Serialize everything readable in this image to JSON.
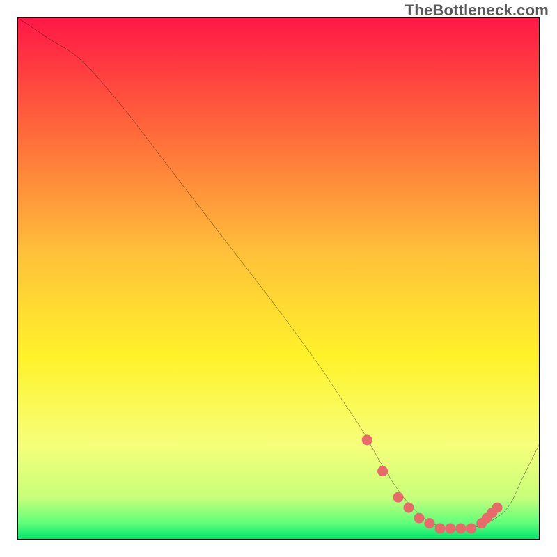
{
  "watermark": "TheBottleneck.com",
  "colors": {
    "gradient_top": "#ff1846",
    "gradient_mid_upper": "#ff6a3a",
    "gradient_mid": "#ffc03a",
    "gradient_mid_lower": "#fff22a",
    "gradient_low": "#f6ff7a",
    "gradient_bottom1": "#c8ff7a",
    "gradient_bottom2": "#5eff7a",
    "gradient_bottom3": "#00e66a",
    "curve": "#000000",
    "marker": "#e96a6a",
    "border": "#000000"
  },
  "chart_data": {
    "type": "line",
    "title": "",
    "xlabel": "",
    "ylabel": "",
    "xlim": [
      0,
      100
    ],
    "ylim": [
      0,
      100
    ],
    "grid": false,
    "legend": false,
    "series": [
      {
        "name": "bottleneck-curve",
        "x": [
          0,
          6,
          12,
          20,
          30,
          40,
          50,
          58,
          62,
          66,
          70,
          74,
          78,
          82,
          86,
          90,
          94,
          97,
          100
        ],
        "y": [
          100,
          96,
          92,
          83,
          70,
          57,
          44,
          33,
          27,
          21,
          14,
          8,
          4,
          2,
          2,
          3,
          6,
          12,
          18
        ]
      }
    ],
    "markers": {
      "name": "highlight-points",
      "x": [
        67,
        70,
        73,
        75,
        77,
        79,
        81,
        83,
        85,
        87,
        89,
        90,
        91,
        92
      ],
      "y": [
        19,
        13,
        8,
        6,
        4,
        3,
        2,
        2,
        2,
        2,
        3,
        4,
        5,
        6
      ]
    }
  }
}
